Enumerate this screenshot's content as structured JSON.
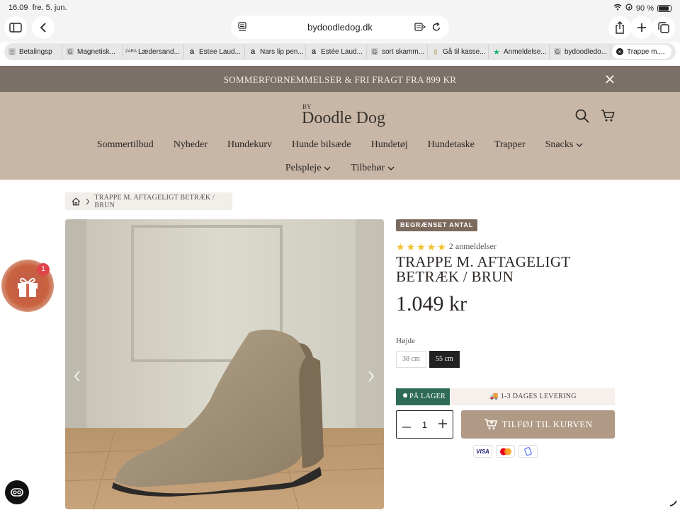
{
  "status": {
    "time": "16.09",
    "date": "fre. 5. jun.",
    "battery": "90 %",
    "battery_level": 0.9
  },
  "browser": {
    "url": "bydoodledog.dk",
    "tabs": [
      {
        "label": "Betalingsp",
        "icon": "payment-favicon"
      },
      {
        "label": "Magnetisk...",
        "icon": "google-favicon"
      },
      {
        "label": "Lædersand...",
        "icon": "zara-favicon"
      },
      {
        "label": "Estee Laud...",
        "icon": "amazon-favicon"
      },
      {
        "label": "Nars lip pen...",
        "icon": "amazon-favicon"
      },
      {
        "label": "Estée Laud...",
        "icon": "amazon-favicon"
      },
      {
        "label": "sort skamm...",
        "icon": "google-favicon"
      },
      {
        "label": "Gå til kasse...",
        "icon": "shop-favicon"
      },
      {
        "label": "Anmeldelse...",
        "icon": "trustpilot-favicon"
      },
      {
        "label": "bydoodledo...",
        "icon": "google-favicon"
      },
      {
        "label": "Trappe m....",
        "icon": "close-tab-icon",
        "active": true
      }
    ]
  },
  "announcement": {
    "text": "SOMMERFORNEMMELSER & FRI FRAGT FRA 899 KR"
  },
  "logo": {
    "by": "BY",
    "name": "Doodle Dog"
  },
  "nav": {
    "row1": [
      "Sommertilbud",
      "Nyheder",
      "Hundekurv",
      "Hunde bilsæde",
      "Hundetøj",
      "Hundetaske",
      "Trapper",
      "Snacks"
    ],
    "row2": [
      "Pelspleje",
      "Tilbehør"
    ]
  },
  "breadcrumb": {
    "current": "TRAPPE M. AFTAGELIGT BETRÆK / BRUN"
  },
  "gift": {
    "count": "1"
  },
  "product": {
    "badge": "BEGRÆNSET ANTAL",
    "rating": 5,
    "reviews": "2 anmeldelser",
    "title_line1": "TRAPPE M. AFTAGELIGT",
    "title_line2": "BETRÆK / BRUN",
    "price": "1.049 kr",
    "height_label": "Højde",
    "options": [
      "38 cm",
      "55 cm"
    ],
    "selected_option": "55 cm",
    "stock": "PÅ LAGER",
    "delivery": "1-3 DAGES LEVERING",
    "quantity": "1",
    "add_to_cart": "TILFØJ TIL KURVEN",
    "payments": [
      "VISA",
      "Mastercard",
      "MobilePay"
    ]
  },
  "colors": {
    "header_bg": "#c8b7a6",
    "announce_bg": "#7b7068",
    "cart_button": "#b09a86",
    "stock_green": "#2e6b55",
    "badge": "#7b6a5e"
  }
}
